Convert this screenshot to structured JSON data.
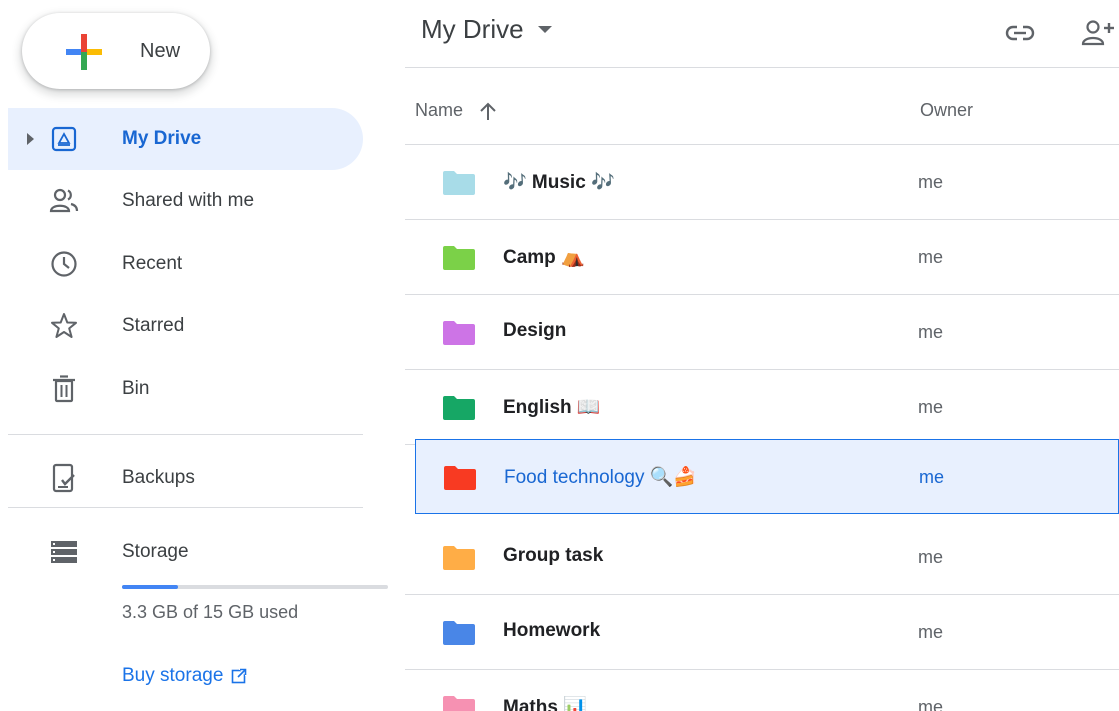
{
  "sidebar": {
    "new_label": "New",
    "items": [
      {
        "label": "My Drive"
      },
      {
        "label": "Shared with me"
      },
      {
        "label": "Recent"
      },
      {
        "label": "Starred"
      },
      {
        "label": "Bin"
      },
      {
        "label": "Backups"
      },
      {
        "label": "Storage"
      }
    ],
    "storage_used_fraction": 0.21,
    "storage_text": "3.3 GB of 15 GB used",
    "buy_storage": "Buy storage"
  },
  "main": {
    "title": "My Drive",
    "columns": {
      "name": "Name",
      "owner": "Owner"
    },
    "rows": [
      {
        "name": "🎶 Music 🎶",
        "owner": "me",
        "color": "#a8dce8"
      },
      {
        "name": "Camp ⛺",
        "owner": "me",
        "color": "#7bd148"
      },
      {
        "name": "Design",
        "owner": "me",
        "color": "#cd74e6"
      },
      {
        "name": "English 📖",
        "owner": "me",
        "color": "#16a765"
      },
      {
        "name": "Food technology 🔍🍰",
        "owner": "me",
        "color": "#f83a22",
        "selected": true
      },
      {
        "name": "Group task",
        "owner": "me",
        "color": "#ffad46"
      },
      {
        "name": "Homework",
        "owner": "me",
        "color": "#4986e7"
      },
      {
        "name": "Maths 📊",
        "owner": "me",
        "color": "#f691b2"
      }
    ]
  },
  "colors": {
    "accent": "#1a73e8",
    "active_bg": "#e8f0fe"
  }
}
